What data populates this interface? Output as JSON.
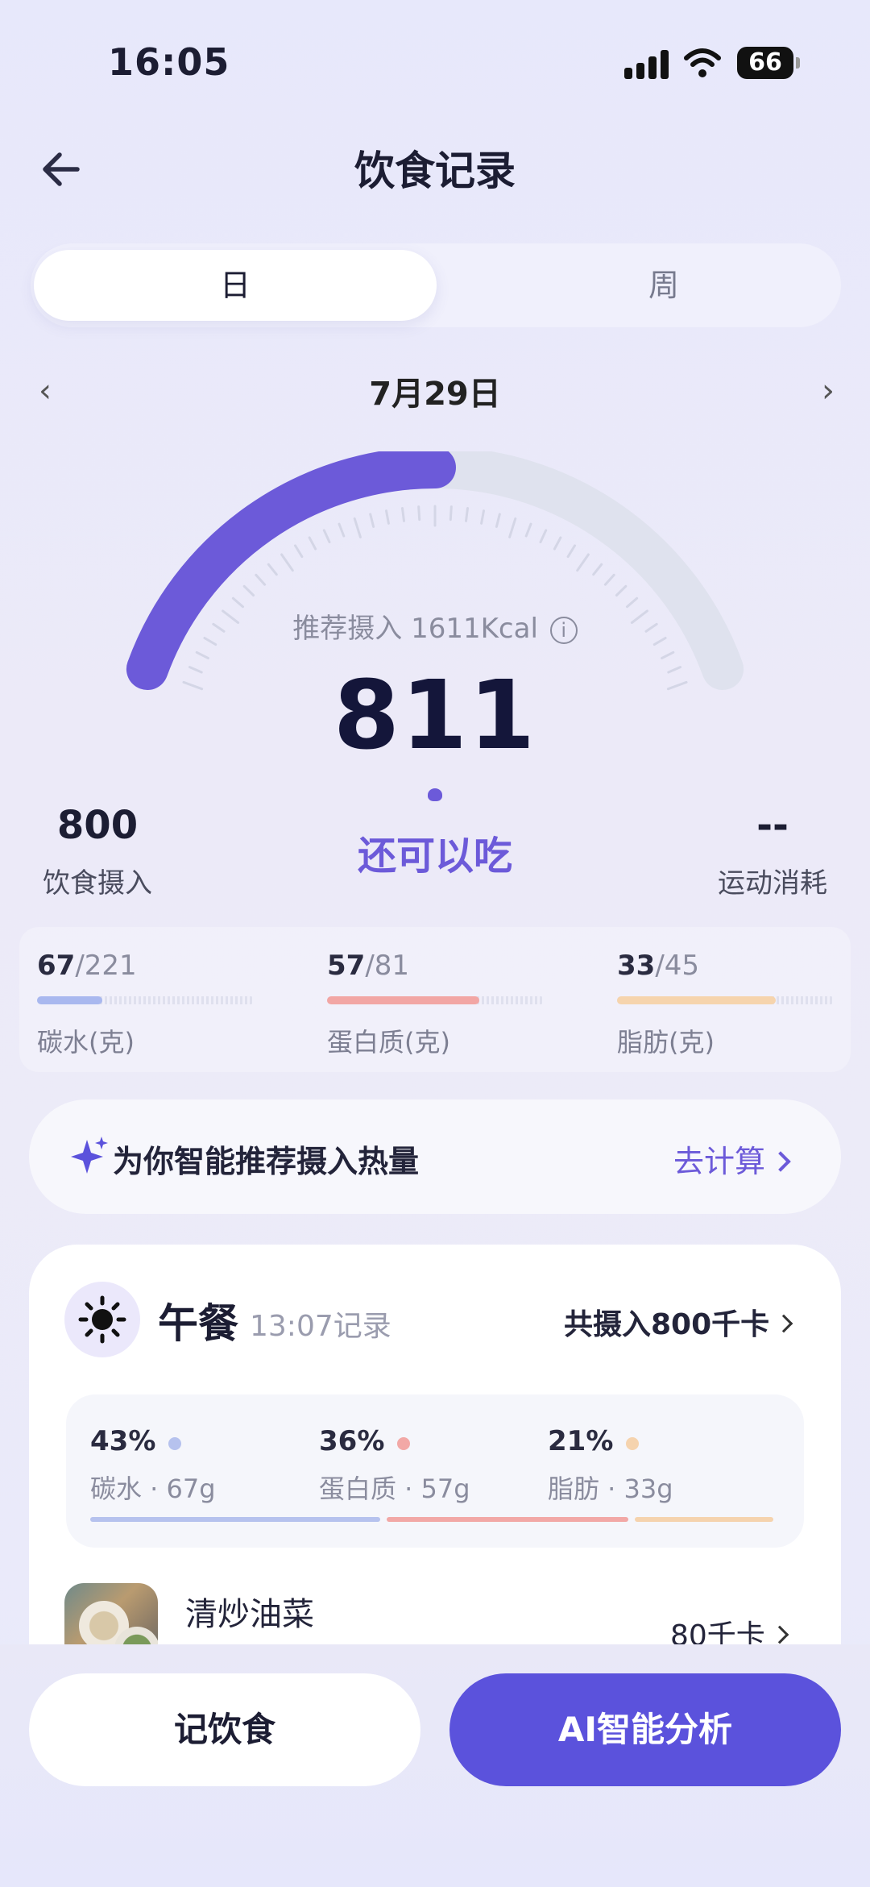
{
  "status": {
    "time": "16:05",
    "battery": "66"
  },
  "header": {
    "title": "饮食记录"
  },
  "segment": {
    "day": "日",
    "week": "周"
  },
  "date": {
    "label": "7月29日",
    "prev": "‹",
    "next": "›"
  },
  "gauge": {
    "recommended_label": "推荐摄入 1611Kcal",
    "info_glyph": "i",
    "value": "811",
    "remaining_label": "还可以吃",
    "progress_fraction": 0.5,
    "colors": {
      "progress": "#6c5ad9",
      "track": "#dfe2ee"
    }
  },
  "stats": {
    "intake_value": "800",
    "intake_label": "饮食摄入",
    "exercise_value": "--",
    "exercise_label": "运动消耗"
  },
  "macros": [
    {
      "value": "67",
      "total": "/221",
      "label": "碳水(克)",
      "color": "#a9b8ef",
      "fraction": 0.3
    },
    {
      "value": "57",
      "total": "/81",
      "label": "蛋白质(克)",
      "color": "#f2a6a4",
      "fraction": 0.7
    },
    {
      "value": "33",
      "total": "/45",
      "label": "脂肪(克)",
      "color": "#f6d4ad",
      "fraction": 0.73
    }
  ],
  "recommend": {
    "text": "为你智能推荐摄入热量",
    "action": "去计算"
  },
  "meal": {
    "title": "午餐",
    "time": "13:07记录",
    "total": "共摄入800千卡",
    "breakdown": [
      {
        "pct": "43%",
        "label": "碳水 · 67g",
        "color": "#b6c2ee"
      },
      {
        "pct": "36%",
        "label": "蛋白质 · 57g",
        "color": "#f2a8a6"
      },
      {
        "pct": "21%",
        "label": "脂肪 · 33g",
        "color": "#f5d3ae"
      }
    ],
    "food": {
      "name": "清炒油菜",
      "kcal": "80千卡"
    }
  },
  "bottom": {
    "record": "记饮食",
    "ai": "AI智能分析"
  },
  "colors": {
    "accent": "#6c5ad9",
    "primary_button": "#5b52dc"
  }
}
